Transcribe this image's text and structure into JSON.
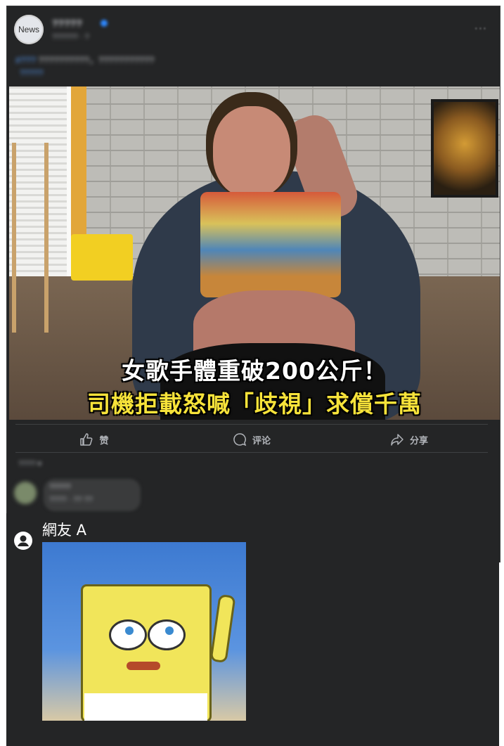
{
  "post": {
    "avatar_label": "News",
    "page_name": "?????",
    "time": "?????? · ?",
    "more": "···",
    "caption_tag": "#???",
    "caption_text": "??????????，???????????",
    "caption_link": "?????"
  },
  "photo": {
    "headline_line1": "女歌手體重破200公斤！",
    "headline_line2": "司機拒載怒喊「歧視」求償千萬"
  },
  "actions": {
    "like_label": "赞",
    "comment_label": "评论",
    "share_label": "分享"
  },
  "comments": {
    "sort_label": "???? ▾",
    "first_comment_name": "?????",
    "first_comment_text": "???? · ?? ??"
  },
  "reply": {
    "user_name": "網友 A"
  },
  "colors": {
    "background": "#242526",
    "headline_yellow": "#f7e33a",
    "link_blue": "#5aa0ff"
  }
}
